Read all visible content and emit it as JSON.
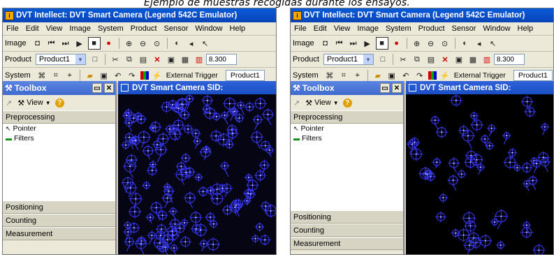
{
  "caption": "Ejemplo de muestras recogidas durante los ensayos.",
  "left": {
    "window_title": "DVT Intellect: DVT Smart Camera (Legend 542C Emulator)",
    "menu": [
      "File",
      "Edit",
      "View",
      "Image",
      "System",
      "Product",
      "Sensor",
      "Window",
      "Help"
    ],
    "toolbar_image_label": "Image",
    "toolbar_product_label": "Product",
    "product_select_value": "Product1",
    "exposure_value": "8.300",
    "toolbar_system_label": "System",
    "external_trigger_label": "External Trigger",
    "product_box_value": "Product1",
    "toolbox_title": "Toolbox",
    "toolbox_view_label": "View",
    "sections": {
      "preprocessing": "Preprocessing",
      "positioning": "Positioning",
      "counting": "Counting",
      "measurement": "Measurement"
    },
    "tools": {
      "pointer": "Pointer",
      "filters": "Filters"
    },
    "viewer_title": "DVT Smart Camera SID:"
  },
  "right": {
    "window_title": "DVT Intellect: DVT Smart Camera (Legend 542C Emulator)",
    "menu": [
      "File",
      "Edit",
      "View",
      "Image",
      "System",
      "Product",
      "Sensor",
      "Window",
      "Help"
    ],
    "toolbar_image_label": "Image",
    "toolbar_product_label": "Product",
    "product_select_value": "Product1",
    "exposure_value": "8.300",
    "toolbar_system_label": "System",
    "external_trigger_label": "External Trigger",
    "product_box_value": "Product1",
    "toolbox_title": "Toolbox",
    "toolbox_view_label": "View",
    "sections": {
      "preprocessing": "Preprocessing",
      "positioning": "Positioning",
      "counting": "Counting",
      "measurement": "Measurement"
    },
    "tools": {
      "pointer": "Pointer",
      "filters": "Filters"
    },
    "viewer_title": "DVT Smart Camera SID:"
  },
  "colors": {
    "title_blue": "#0a5ad8",
    "marker_blue": "#3a3aff",
    "viewer_bg": "#000000"
  },
  "icons": [
    "app-icon",
    "camera-icon",
    "first-icon",
    "last-icon",
    "play-icon",
    "stop-icon",
    "record-icon",
    "zoom-in-icon",
    "zoom-out-icon",
    "zoom-fit-icon",
    "cut-icon",
    "copy-icon",
    "paste-icon",
    "delete-icon",
    "trigger-icon",
    "wrench-icon",
    "help-icon"
  ]
}
